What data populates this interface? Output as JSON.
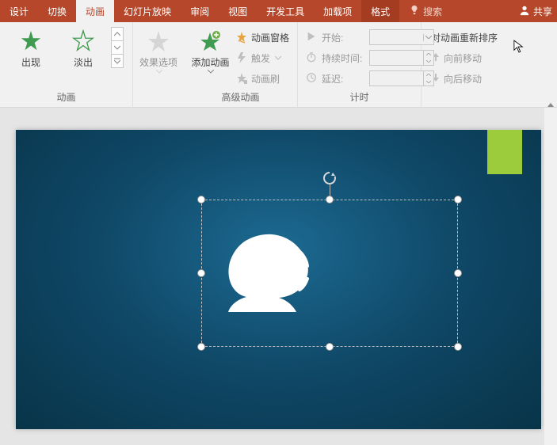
{
  "tabs": {
    "design": "设计",
    "transition": "切换",
    "animation": "动画",
    "slideshow": "幻灯片放映",
    "review": "审阅",
    "view": "视图",
    "devtools": "开发工具",
    "addins": "加载项",
    "format": "格式",
    "search": "搜索",
    "share": "共享"
  },
  "ribbon": {
    "groups": {
      "animation": "动画",
      "advanced": "高级动画",
      "timing": "计时",
      "reorder_header": "对动画重新排序"
    },
    "gallery": {
      "appear": "出现",
      "fade": "淡出"
    },
    "effect_options": "效果选项",
    "add_animation": "添加动画",
    "animation_pane": "动画窗格",
    "trigger": "触发",
    "animation_painter": "动画刷",
    "timing": {
      "start_label": "开始:",
      "duration_label": "持续时间:",
      "delay_label": "延迟:",
      "start_value": "",
      "duration_value": "",
      "delay_value": ""
    },
    "reorder": {
      "move_earlier": "向前移动",
      "move_later": "向后移动"
    }
  },
  "icons": {
    "search": "search-icon",
    "share": "share-icon"
  }
}
